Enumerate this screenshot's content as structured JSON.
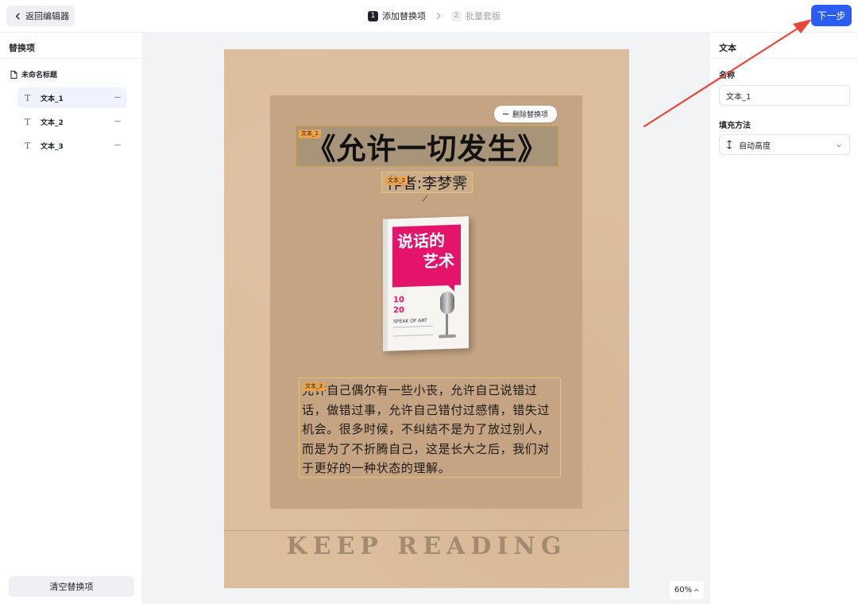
{
  "header": {
    "back_label": "返回编辑器",
    "steps": [
      {
        "num": "1",
        "label": "添加替换项"
      },
      {
        "num": "2",
        "label": "批量套版"
      }
    ],
    "next_label": "下一步"
  },
  "left_panel": {
    "title": "替换项",
    "doc_name": "未命名标题",
    "items": [
      {
        "label": "文本_1"
      },
      {
        "label": "文本_2"
      },
      {
        "label": "文本_3"
      }
    ],
    "clear_label": "清空替换项"
  },
  "canvas": {
    "delete_label": "删除替换项",
    "title_tag": "文本_1",
    "title_text": "《允许一切发生》",
    "author_tag": "文本_2",
    "author_text": "作者:李梦霁",
    "book": {
      "title_line1": "说话的",
      "title_line2": "艺术",
      "line_10": "10",
      "line_20": "20",
      "speak": "SPEAK OF ART"
    },
    "body_tag": "文本_3",
    "body_text": "允许自己偶尔有一些小丧，允许自己说错过话，做错过事，允许自己错付过感情，错失过机会。很多时候，不纠结不是为了放过别人，而是为了不折腾自己，这是长大之后，我们对于更好的一种状态的理解。",
    "footer_text": "KEEP READING",
    "zoom": "60%"
  },
  "right_panel": {
    "title": "文本",
    "name_label": "名称",
    "name_value": "文本_1",
    "fill_label": "填充方法",
    "fill_value": "自动高度"
  },
  "colors": {
    "accent": "#2c5df2",
    "tag": "#f0a24a",
    "annotation_arrow": "#e8453c"
  }
}
